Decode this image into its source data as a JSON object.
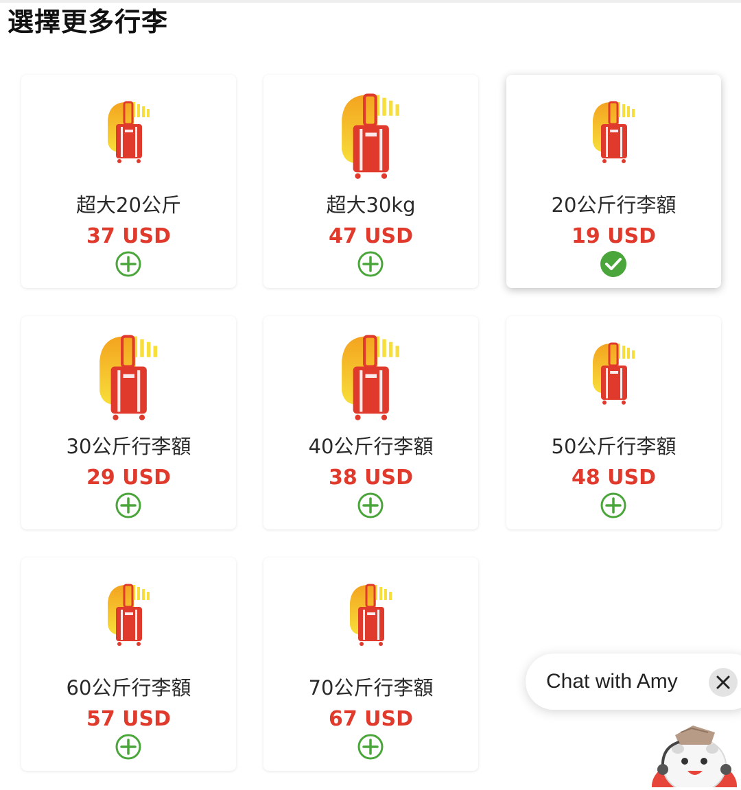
{
  "page": {
    "title": "選擇更多行李"
  },
  "colors": {
    "price": "#e03a2d",
    "add_icon": "#4aa53a",
    "selected_icon": "#4aa53a",
    "bag_body": "#e03a2d",
    "bag_back_top": "#f4a31f",
    "bag_back_bottom": "#f7de3a"
  },
  "baggage_options": [
    {
      "label": "超大20公斤",
      "price": "37 USD",
      "selected": false,
      "action_icon": "add-circle-icon"
    },
    {
      "label": "超大30kg",
      "price": "47 USD",
      "selected": false,
      "action_icon": "add-circle-icon"
    },
    {
      "label": "20公斤行李額",
      "price": "19 USD",
      "selected": true,
      "action_icon": "check-circle-icon"
    },
    {
      "label": "30公斤行李額",
      "price": "29 USD",
      "selected": false,
      "action_icon": "add-circle-icon"
    },
    {
      "label": "40公斤行李額",
      "price": "38 USD",
      "selected": false,
      "action_icon": "add-circle-icon"
    },
    {
      "label": "50公斤行李額",
      "price": "48 USD",
      "selected": false,
      "action_icon": "add-circle-icon"
    },
    {
      "label": "60公斤行李額",
      "price": "57 USD",
      "selected": false,
      "action_icon": "add-circle-icon"
    },
    {
      "label": "70公斤行李額",
      "price": "67 USD",
      "selected": false,
      "action_icon": "add-circle-icon"
    }
  ],
  "chat_widget": {
    "label": "Chat with Amy",
    "close_icon": "close-icon",
    "avatar_icon": "chatbot-mascot-icon"
  }
}
